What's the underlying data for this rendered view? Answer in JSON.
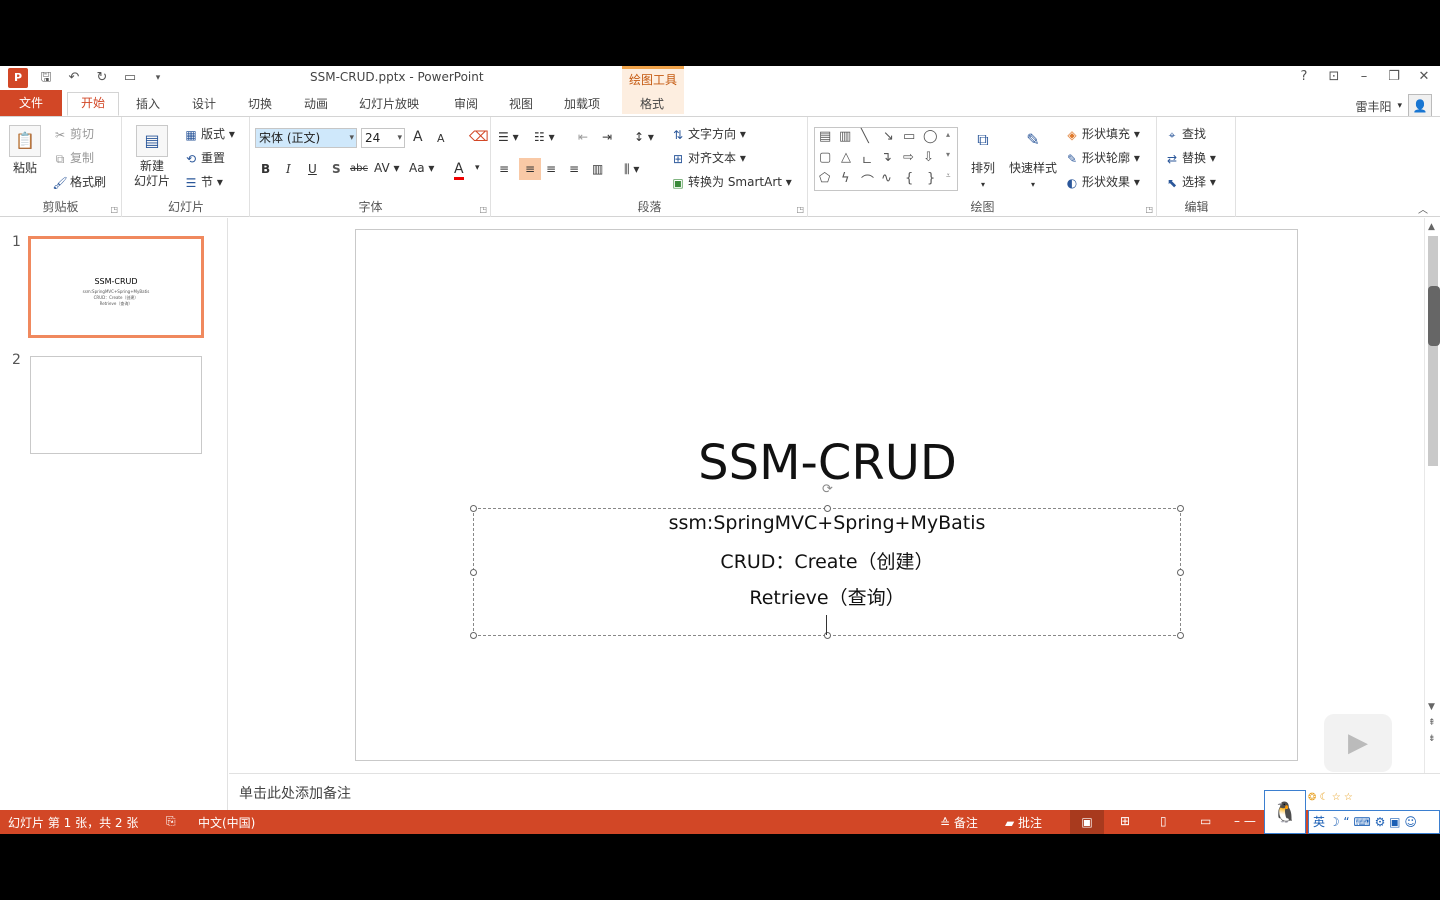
{
  "window": {
    "title": "SSM-CRUD.pptx - PowerPoint",
    "contextual_tools": "绘图工具",
    "controls": [
      "?",
      "⊡",
      "–",
      "❐",
      "✕"
    ]
  },
  "qat": {
    "icons": [
      "powerpoint-logo-icon",
      "save-icon",
      "undo-icon",
      "redo-icon",
      "start-from-beginning-icon",
      "customize-qat-icon"
    ]
  },
  "tabs": {
    "file": "文件",
    "home": "开始",
    "items": [
      "插入",
      "设计",
      "切换",
      "动画",
      "幻灯片放映",
      "审阅",
      "视图",
      "加载项"
    ],
    "format": "格式"
  },
  "user": {
    "name": "雷丰阳"
  },
  "ribbon": {
    "clipboard": {
      "paste": "粘贴",
      "cut": "剪切",
      "copy": "复制",
      "format_painter": "格式刷",
      "label": "剪贴板"
    },
    "slides": {
      "new_slide": "新建",
      "new_slide_2": "幻灯片",
      "layout": "版式",
      "reset": "重置",
      "section": "节",
      "label": "幻灯片"
    },
    "font": {
      "font_name": "宋体 (正文)",
      "font_size": "24",
      "bold": "B",
      "italic": "I",
      "underline": "U",
      "shadow": "S",
      "strikethrough": "abc",
      "spacing": "AV",
      "change_case": "Aa",
      "font_color": "A",
      "grow": "A",
      "shrink": "A",
      "label": "字体"
    },
    "paragraph": {
      "text_direction": "文字方向",
      "align_text": "对齐文本",
      "smartart": "转换为 SmartArt",
      "label": "段落"
    },
    "drawing": {
      "arrange": "排列",
      "quick_styles": "快速样式",
      "shape_fill": "形状填充",
      "shape_outline": "形状轮廓",
      "shape_effects": "形状效果",
      "label": "绘图"
    },
    "editing": {
      "find": "查找",
      "replace": "替换",
      "select": "选择",
      "label": "编辑"
    }
  },
  "thumbnails": [
    {
      "number": "1",
      "title": "SSM-CRUD",
      "lines": [
        "ssm:SpringMVC+Spring+MyBatis",
        "CRUD：Create（创建）",
        "Retrieve（查询）"
      ]
    },
    {
      "number": "2"
    }
  ],
  "slide": {
    "title": "SSM-CRUD",
    "subtitle_lines": [
      "ssm:SpringMVC+Spring+MyBatis",
      "CRUD：Create（创建）",
      "Retrieve（查询）"
    ]
  },
  "notes": {
    "placeholder": "单击此处添加备注"
  },
  "status": {
    "slide_info": "幻灯片 第 1 张，共 2 张",
    "language": "中文(中国)",
    "notes_btn": "备注",
    "comments_btn": "批注"
  },
  "ime": {
    "mode": "英"
  },
  "colors": {
    "accent": "#d24726",
    "selected_thumb": "#f0895e"
  }
}
